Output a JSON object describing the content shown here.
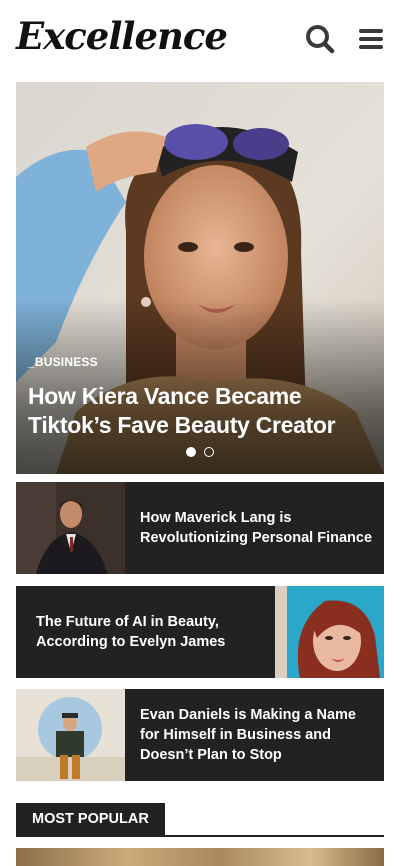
{
  "header": {
    "logo": "Excellence",
    "search_icon": "search-icon",
    "menu_icon": "hamburger-menu-icon"
  },
  "hero": {
    "category": "_BUSINESS",
    "title": "How Kiera Vance Became Tiktok’s Fave Beauty Creator",
    "slides_total": 2,
    "active_slide": 1
  },
  "articles": [
    {
      "title": "How Maverick Lang is Revolutionizing Personal Finance"
    },
    {
      "title": "The Future of AI in Beauty, According to Evelyn James"
    },
    {
      "title": "Evan Daniels is Making a Name for Himself in Business and Doesn’t Plan to Stop"
    }
  ],
  "most_popular": {
    "label": "MOST POPULAR"
  },
  "colors": {
    "card_bg": "#222222",
    "text_light": "#ffffff",
    "brand_dark": "#111111"
  }
}
